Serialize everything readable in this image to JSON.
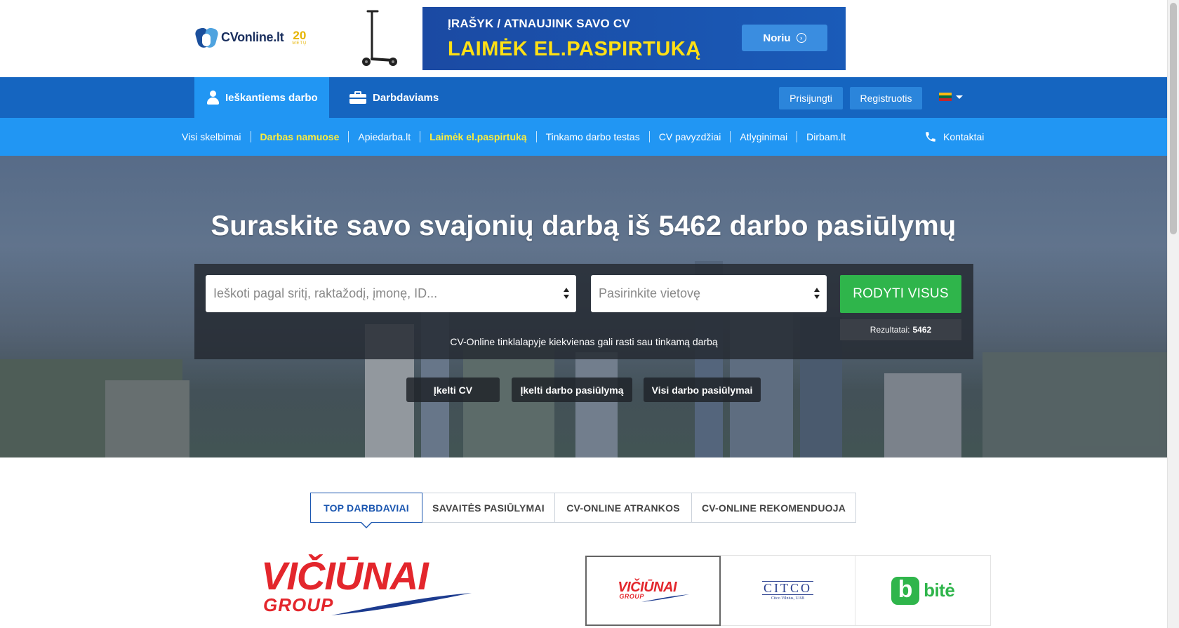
{
  "header": {
    "logo_text": "CVonline.lt",
    "logo_years_number": "20",
    "logo_years_word": "METŲ",
    "banner": {
      "line1": "ĮRAŠYK / ATNAUJINK SAVO CV",
      "line2": "LAIMĖK EL.PASPIRTUKĄ",
      "button_label": "Noriu"
    }
  },
  "nav": {
    "tabs": [
      {
        "label": "Ieškantiems darbo",
        "active": true,
        "icon": "user-icon"
      },
      {
        "label": "Darbdaviams",
        "active": false,
        "icon": "briefcase-icon"
      }
    ],
    "login_label": "Prisijungti",
    "register_label": "Registruotis",
    "language_flag": "lt",
    "flag_colors": [
      "#fdb913",
      "#006a44",
      "#c1272d"
    ]
  },
  "subnav": {
    "links": [
      {
        "label": "Visi skelbimai",
        "highlight": false
      },
      {
        "label": "Darbas namuose",
        "highlight": true
      },
      {
        "label": "Apiedarba.lt",
        "highlight": false
      },
      {
        "label": "Laimėk el.paspirtuką",
        "highlight": true
      },
      {
        "label": "Tinkamo darbo testas",
        "highlight": false
      },
      {
        "label": "CV pavyzdžiai",
        "highlight": false
      },
      {
        "label": "Atlyginimai",
        "highlight": false
      },
      {
        "label": "Dirbam.lt",
        "highlight": false
      }
    ],
    "contact_label": "Kontaktai"
  },
  "hero": {
    "title": "Suraskite savo svajonių darbą iš 5462 darbo pasiūlymų",
    "search_placeholder": "Ieškoti pagal sritį, raktažodį, įmonę, ID...",
    "location_placeholder": "Pasirinkite vietovę",
    "search_button": "RODYTI VISUS",
    "results_label": "Rezultatai:",
    "results_count": "5462",
    "tagline": "CV-Online tinklalapyje kiekvienas gali rasti sau tinkamą darbą",
    "buttons": [
      "Įkelti CV",
      "Įkelti darbo pasiūlymą",
      "Visi darbo pasiūlymai"
    ]
  },
  "tabs": [
    {
      "label": "TOP DARBDAVIAI",
      "active": true
    },
    {
      "label": "SAVAITĖS PASIŪLYMAI",
      "active": false
    },
    {
      "label": "CV-ONLINE ATRANKOS",
      "active": false
    },
    {
      "label": "CV-ONLINE REKOMENDUOJA",
      "active": false
    }
  ],
  "employers": {
    "featured": {
      "word": "VIČIŪNAI",
      "sub": "GROUP"
    },
    "grid": [
      {
        "word": "VIČIŪNAI",
        "sub": "GROUP",
        "active": true
      },
      {
        "word": "CITCO",
        "sub": "Citco Vilnius, UAB",
        "active": false
      },
      {
        "word": "bitė",
        "active": false
      }
    ]
  },
  "colors": {
    "primary_nav": "#1565c0",
    "active_nav": "#2196f3",
    "green": "#2fb54b",
    "yellow": "#ffee3a",
    "brand_red": "#e3262c"
  }
}
